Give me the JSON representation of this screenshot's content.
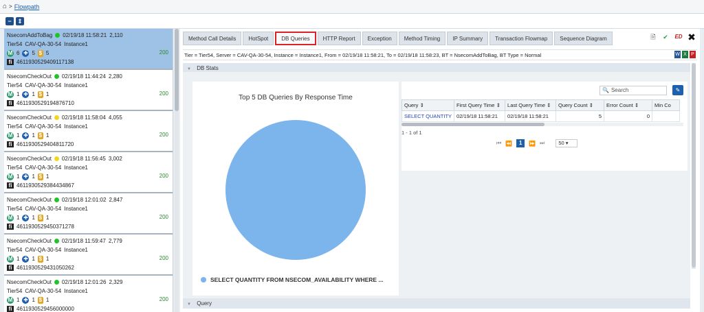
{
  "breadcrumb": {
    "label": "Flowpath"
  },
  "flowpaths": [
    {
      "bt": "NsecomAddToBag",
      "status": "green",
      "time": "02/19/18 11:58:21",
      "duration": "2,110",
      "tier": "Tier54",
      "server": "CAV-QA-30-54",
      "instance": "Instance1",
      "m": "6",
      "db": "5",
      "coin": "5",
      "count": "200",
      "id": "4611930529409117138",
      "selected": true
    },
    {
      "bt": "NsecomCheckOut",
      "status": "green",
      "time": "02/19/18 11:44:24",
      "duration": "2,280",
      "tier": "Tier54",
      "server": "CAV-QA-30-54",
      "instance": "Instance1",
      "m": "1",
      "db": "1",
      "coin": "1",
      "count": "200",
      "id": "4611930529194876710",
      "selected": false
    },
    {
      "bt": "NsecomCheckOut",
      "status": "yellow",
      "time": "02/19/18 11:58:04",
      "duration": "4,055",
      "tier": "Tier54",
      "server": "CAV-QA-30-54",
      "instance": "Instance1",
      "m": "1",
      "db": "1",
      "coin": "1",
      "count": "200",
      "id": "4611930529404811720",
      "selected": false
    },
    {
      "bt": "NsecomCheckOut",
      "status": "yellow",
      "time": "02/19/18 11:56:45",
      "duration": "3,002",
      "tier": "Tier54",
      "server": "CAV-QA-30-54",
      "instance": "Instance1",
      "m": "1",
      "db": "1",
      "coin": "1",
      "count": "200",
      "id": "4611930529384434867",
      "selected": false
    },
    {
      "bt": "NsecomCheckOut",
      "status": "green",
      "time": "02/19/18 12:01:02",
      "duration": "2,847",
      "tier": "Tier54",
      "server": "CAV-QA-30-54",
      "instance": "Instance1",
      "m": "1",
      "db": "1",
      "coin": "1",
      "count": "200",
      "id": "4611930529450371278",
      "selected": false
    },
    {
      "bt": "NsecomCheckOut",
      "status": "green",
      "time": "02/19/18 11:59:47",
      "duration": "2,779",
      "tier": "Tier54",
      "server": "CAV-QA-30-54",
      "instance": "Instance1",
      "m": "1",
      "db": "1",
      "coin": "1",
      "count": "200",
      "id": "4611930529431050262",
      "selected": false
    },
    {
      "bt": "NsecomCheckOut",
      "status": "green",
      "time": "02/19/18 12:01:26",
      "duration": "2,329",
      "tier": "Tier54",
      "server": "CAV-QA-30-54",
      "instance": "Instance1",
      "m": "1",
      "db": "1",
      "coin": "1",
      "count": "200",
      "id": "4611930529456000000",
      "selected": false
    }
  ],
  "tabs": [
    {
      "label": "Method Call Details",
      "active": false
    },
    {
      "label": "HotSpot",
      "active": false
    },
    {
      "label": "DB Queries",
      "active": true
    },
    {
      "label": "HTTP Report",
      "active": false
    },
    {
      "label": "Exception",
      "active": false
    },
    {
      "label": "Method Timing",
      "active": false
    },
    {
      "label": "IP Summary",
      "active": false
    },
    {
      "label": "Transaction Flowmap",
      "active": false
    },
    {
      "label": "Sequence Diagram",
      "active": false
    }
  ],
  "top_icons": {
    "ed_label": "ED",
    "close": "✖"
  },
  "info_line": "Tier = Tier54, Server = CAV-QA-30-54, Instance = Instance1, From = 02/19/18 11:58:21, To = 02/19/18 11:58:23, BT = NsecomAddToBag, BT Type = Normal",
  "sections": {
    "db_stats": "DB Stats",
    "query": "Query"
  },
  "chart_data": {
    "type": "pie",
    "title": "Top 5 DB Queries By Response Time",
    "slices": [
      {
        "label": "SELECT QUANTITY FROM NSECOM_AVAILABILITY WHERE ...",
        "value": 100,
        "color": "#7cb5ec"
      }
    ]
  },
  "table": {
    "search_placeholder": "Search",
    "columns": [
      "Query",
      "First Query Time",
      "Last Query Time",
      "Query Count",
      "Error Count",
      "Min Co"
    ],
    "rows": [
      [
        "SELECT QUANTITY",
        "02/19/18 11:58:21",
        "02/19/18 11:58:21",
        "5",
        "0",
        ""
      ]
    ],
    "page_info": "1 - 1 of 1",
    "current_page": "1",
    "page_size": "50"
  },
  "colors": {
    "accent": "#1e5fae",
    "selected_row": "#9ec2e6",
    "active_tab_border": "#d8222a"
  }
}
